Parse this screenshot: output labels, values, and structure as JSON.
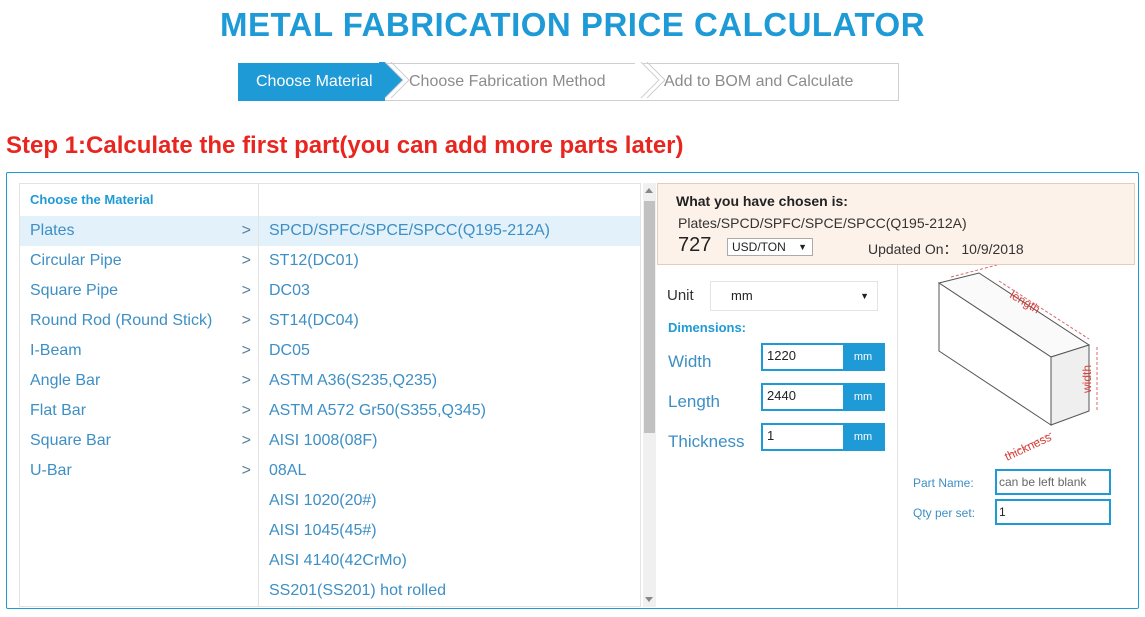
{
  "title": "METAL FABRICATION PRICE CALCULATOR",
  "steps": [
    {
      "label": "Choose Material",
      "active": true
    },
    {
      "label": "Choose Fabrication Method",
      "active": false
    },
    {
      "label": "Add to BOM and Calculate",
      "active": false
    }
  ],
  "step_heading": "Step 1:Calculate the first part(you can add more parts later)",
  "categories": {
    "header": "Choose the Material",
    "items": [
      "Plates",
      "Circular Pipe",
      "Square Pipe",
      "Round Rod (Round Stick)",
      "I-Beam",
      "Angle Bar",
      "Flat Bar",
      "Square Bar",
      "U-Bar"
    ],
    "arrow": ">"
  },
  "materials": [
    "SPCD/SPFC/SPCE/SPCC(Q195-212A)",
    "ST12(DC01)",
    "DC03",
    "ST14(DC04)",
    "DC05",
    "ASTM A36(S235,Q235)",
    "ASTM A572 Gr50(S355,Q345)",
    "AISI 1008(08F)",
    "08AL",
    "AISI 1020(20#)",
    "AISI 1045(45#)",
    "AISI 4140(42CrMo)",
    "SS201(SS201) hot rolled"
  ],
  "chosen": {
    "heading": "What you have chosen is:",
    "path": "Plates/SPCD/SPFC/SPCE/SPCC(Q195-212A)",
    "price": "727",
    "currency": "USD/TON",
    "updated": "Updated On： 10/9/2018"
  },
  "form": {
    "unit_label": "Unit",
    "unit_value": "mm",
    "dimensions_label": "Dimensions:",
    "fields": [
      {
        "label": "Width",
        "value": "1220",
        "unit": "mm"
      },
      {
        "label": "Length",
        "value": "2440",
        "unit": "mm"
      },
      {
        "label": "Thickness",
        "value": "1",
        "unit": "mm"
      }
    ],
    "part_name_label": "Part Name:",
    "part_name_placeholder": "can be left blank",
    "qty_label": "Qty per set:",
    "qty_value": "1"
  },
  "diagram": {
    "length": "length",
    "width": "width",
    "thickness": "thickness"
  },
  "colors": {
    "accent": "#1e9ad6",
    "heading_red": "#e8261f",
    "selected_row": "#e2f1fa",
    "chosen_bg": "#fdf2ea"
  }
}
